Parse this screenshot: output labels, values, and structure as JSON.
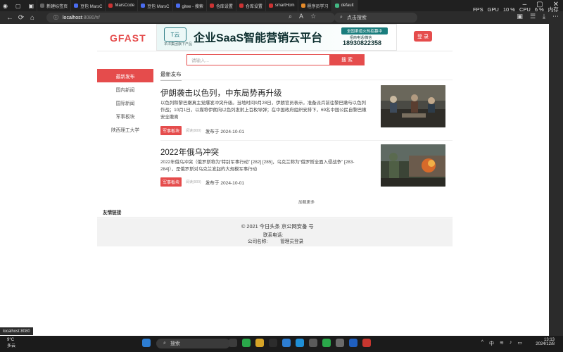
{
  "overlay": {
    "fps_label": "FPS",
    "gpu_label": "GPU",
    "gpu_value": "10 %",
    "cpu_label": "CPU",
    "cpu_value": "6 %",
    "memory_label": "内存"
  },
  "browser": {
    "tabs": [
      {
        "label": "新建标签页"
      },
      {
        "label": "豆包 MarsC"
      },
      {
        "label": "MarsCode"
      },
      {
        "label": "豆包 MarsC"
      },
      {
        "label": "gitee - 搜索"
      },
      {
        "label": "仓库设置"
      },
      {
        "label": "仓库设置"
      },
      {
        "label": "smartHom"
      },
      {
        "label": "程序员学习"
      },
      {
        "label": "default"
      }
    ],
    "url": "localhost:8080/#/",
    "url_host": "localhost",
    "url_rest": ":8080/#/",
    "search_placeholder": "点击搜索",
    "status_url": "localhost:8080"
  },
  "site": {
    "brand": "GFAST",
    "banner": {
      "logo_text": "T云",
      "logo_caption": "羊洋集团旗下产品",
      "headline": "企业SaaS智能营销云平台",
      "badge": "全国渠道火热招募中",
      "sub": "招商电话/微信",
      "phone": "18930822358"
    },
    "login_label": "登 录",
    "search": {
      "placeholder": "请输入...",
      "button": "搜 索"
    },
    "sidebar": [
      {
        "label": "最新发布",
        "active": true
      },
      {
        "label": "国内新闻",
        "active": false
      },
      {
        "label": "国际新闻",
        "active": false
      },
      {
        "label": "军事板块",
        "active": false
      },
      {
        "label": "陕西理工大学",
        "active": false
      }
    ],
    "section_title": "最新发布",
    "articles": [
      {
        "title": "伊朗袭击以色列，中东局势再升级",
        "desc": "以色列和黎巴嫩真主党爆发冲突升级。当地时间9月28日，伊朗官员表示，准备派兵前往黎巴嫩与以色列作战；10月1日，以媒称伊朗向以色列发射上百枚导弹；在中国政府组织安排下，69名中国公民自黎巴嫩安全撤离",
        "tag": "军事板块",
        "reads": "阅读(900)",
        "posted": "发布于 2024-10-01"
      },
      {
        "title": "2022年俄乌冲突",
        "desc": "2022年俄乌冲突（俄罗斯称为“特别军事行动” [282] [285]，乌克兰称为“俄罗斯全面入侵战争” [283-284]），是俄罗斯对乌克兰发起的大规模军事行动",
        "tag": "军事板块",
        "reads": "阅读(900)",
        "posted": "发布于 2024-10-01"
      }
    ],
    "load_more": "加载更多",
    "friend_links_label": "友情链接",
    "footer": {
      "copyright": "© 2021 今日头条 京公网安备 号",
      "contact": "联系电话:",
      "company": "公司名称:",
      "admin_login": "管理员登录"
    }
  },
  "taskbar": {
    "temp": "9°C",
    "weather": "多云",
    "search_placeholder": "搜索",
    "ime": "中",
    "time": "13:13",
    "date": "2024/12/8"
  }
}
